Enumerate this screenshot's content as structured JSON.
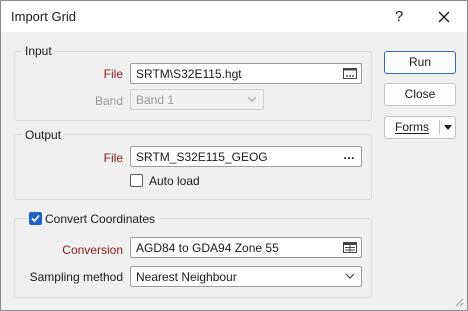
{
  "window": {
    "title": "Import Grid",
    "help_glyph": "?"
  },
  "input": {
    "legend": "Input",
    "file_label": "File",
    "file_value": "SRTM\\S32E115.hgt",
    "band_label": "Band",
    "band_value": "Band 1"
  },
  "output": {
    "legend": "Output",
    "file_label": "File",
    "file_value": "SRTM_S32E115_GEOG",
    "file_btn": "...",
    "autoload_label": "Auto load",
    "autoload_checked": false
  },
  "convert": {
    "label": "Convert Coordinates",
    "checked": true,
    "conversion_label": "Conversion",
    "conversion_value": "AGD84 to GDA94 Zone 55",
    "sampling_label": "Sampling method",
    "sampling_value": "Nearest Neighbour"
  },
  "buttons": {
    "run": "Run",
    "close": "Close",
    "forms": "Forms"
  },
  "colors": {
    "required_label": "#8b1a1a",
    "accent": "#1f62c4",
    "disabled_text": "#9a9a9a"
  }
}
